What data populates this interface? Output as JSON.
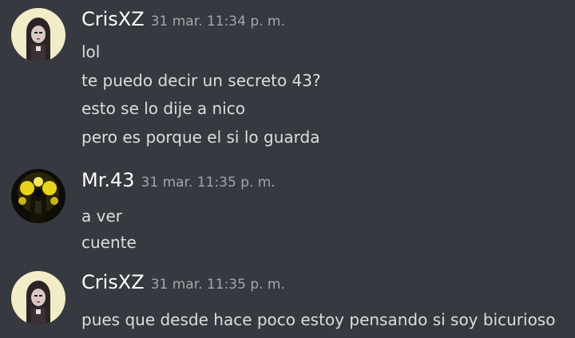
{
  "messages": [
    {
      "author": "CrisXZ",
      "timestamp": "31 mar. 11:34 p. m.",
      "avatar_icon": "anime-girl-avatar",
      "lines": [
        "lol",
        "te puedo decir un secreto 43?",
        "esto se lo dije a nico",
        "pero es porque el si lo guarda"
      ]
    },
    {
      "author": "Mr.43",
      "timestamp": "31 mar. 11:35 p. m.",
      "avatar_icon": "dark-figure-yellow-glow-avatar",
      "lines": [
        "a ver",
        "cuente"
      ]
    },
    {
      "author": "CrisXZ",
      "timestamp": "31 mar. 11:35 p. m.",
      "avatar_icon": "anime-girl-avatar",
      "lines": [
        "pues que desde hace poco estoy pensando si soy bicurioso"
      ]
    }
  ],
  "colors": {
    "background": "#36393f",
    "username": "#ffffff",
    "timestamp": "#a3a6aa",
    "text": "#dcddde"
  }
}
